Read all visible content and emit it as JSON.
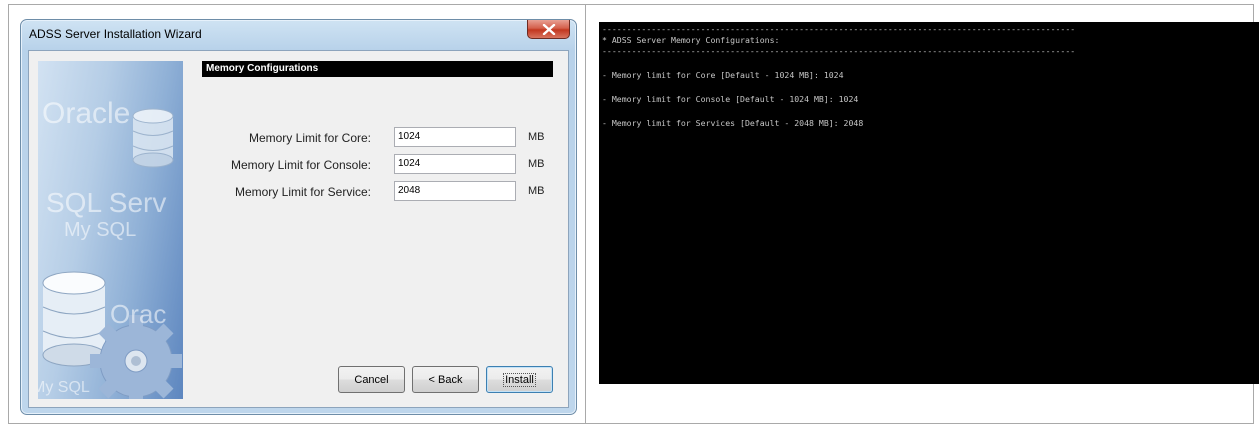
{
  "wizard": {
    "title": "ADSS Server Installation Wizard",
    "section_title": "Memory Configurations",
    "fields": [
      {
        "label": "Memory Limit for Core:",
        "value": "1024",
        "unit": "MB"
      },
      {
        "label": "Memory Limit for Console:",
        "value": "1024",
        "unit": "MB"
      },
      {
        "label": "Memory Limit for Service:",
        "value": "2048",
        "unit": "MB"
      }
    ],
    "buttons": {
      "cancel": "Cancel",
      "back": "< Back",
      "install": "Install"
    },
    "side_image_text": [
      "Oracle",
      "SQL Serv",
      "My SQL",
      "Orac",
      "My SQL"
    ]
  },
  "console": {
    "lines": [
      "------------------------------------------------------------------------------------------------",
      "* ADSS Server Memory Configurations:",
      "------------------------------------------------------------------------------------------------",
      "- Memory limit for Core [Default - 1024 MB]: 1024",
      "- Memory limit for Console [Default - 1024 MB]: 1024",
      "- Memory limit for Services [Default - 2048 MB]: 2048"
    ]
  },
  "colors": {
    "console_background": "#000000",
    "console_text": "#c6c6c6",
    "section_bar": "#000000",
    "window_frame": "#bed6ec"
  }
}
